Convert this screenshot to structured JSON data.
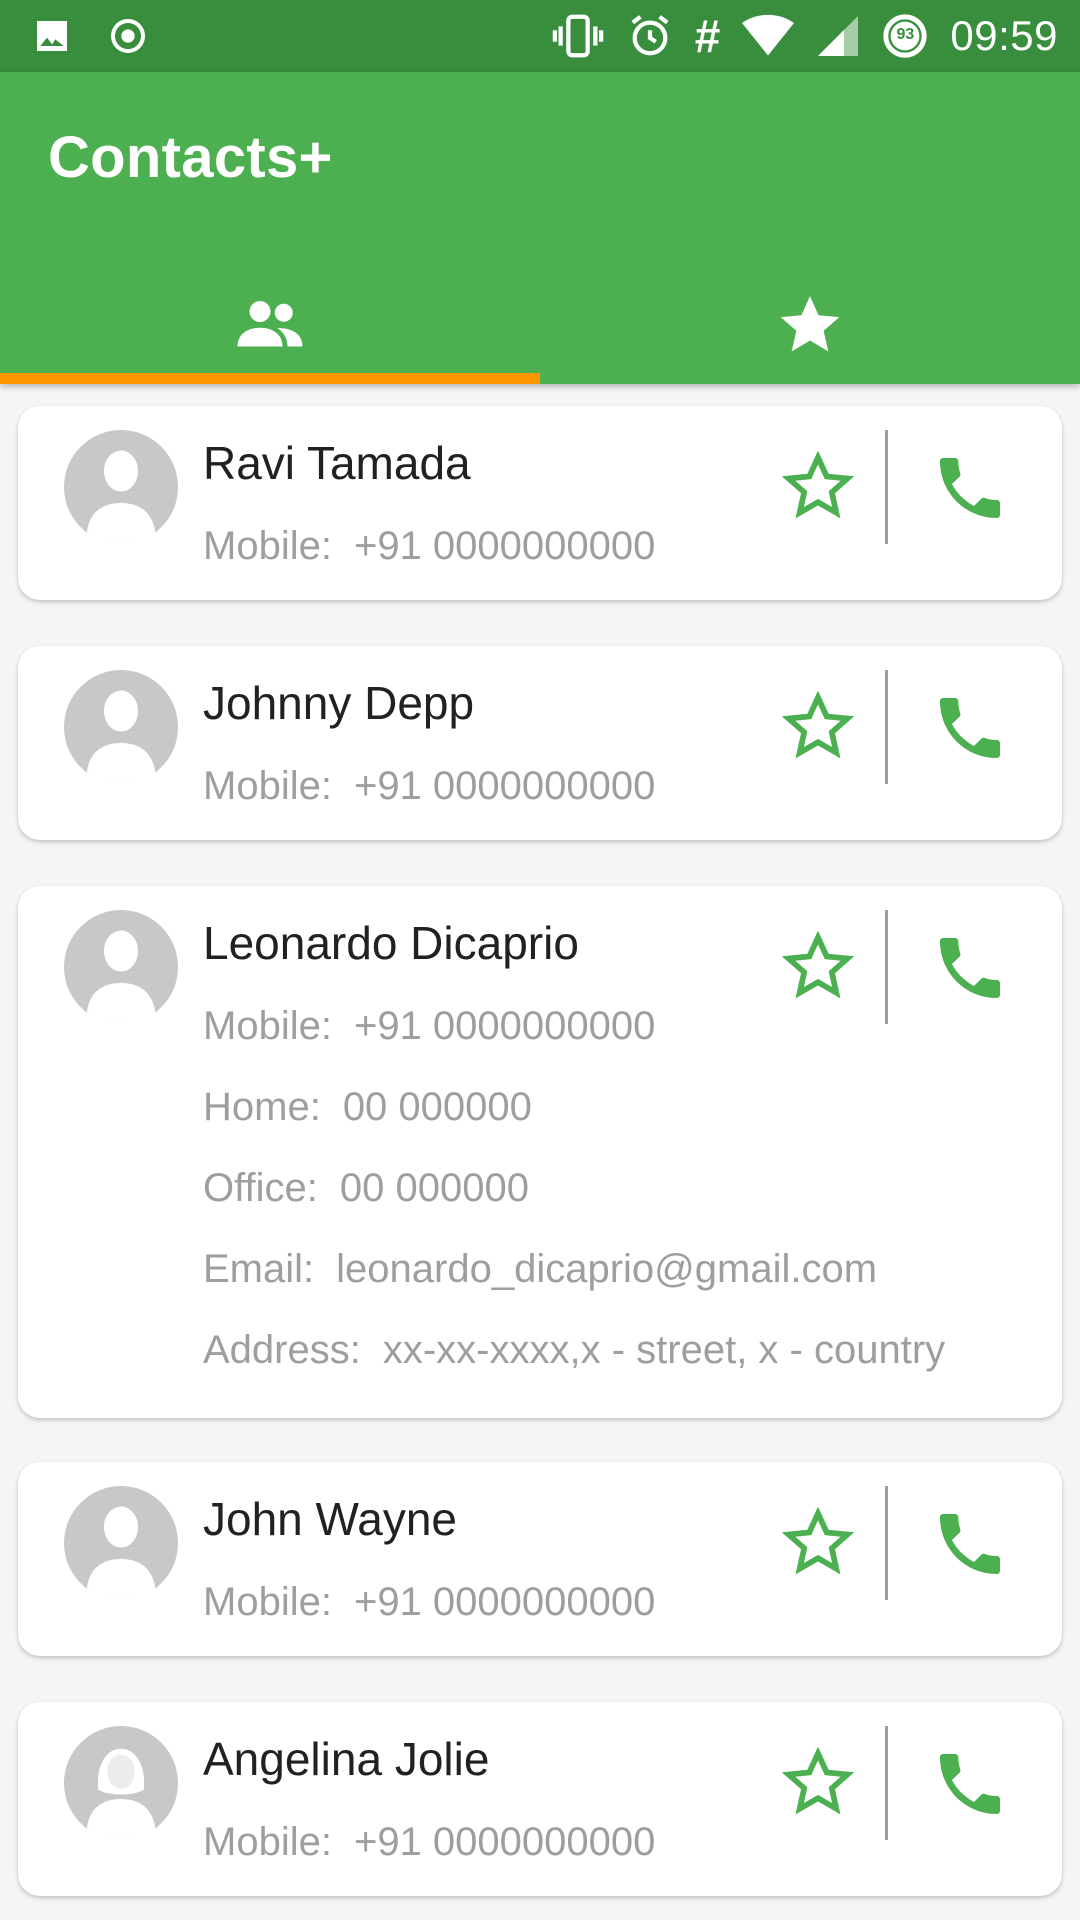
{
  "status_bar": {
    "time": "09:59",
    "battery_level": "93",
    "left_icons": [
      "image-icon",
      "record-icon"
    ],
    "right_icons": [
      "vibrate-icon",
      "alarm-icon",
      "hash-icon",
      "wifi-icon",
      "signal-icon",
      "battery-icon"
    ],
    "hash_symbol": "#"
  },
  "app_bar": {
    "title": "Contacts+",
    "color": "#4caf50",
    "status_color": "#388e3c",
    "tabs": [
      {
        "icon": "contacts-icon",
        "selected": true
      },
      {
        "icon": "star-icon",
        "selected": false
      }
    ],
    "indicator_color": "#ff9800"
  },
  "contacts": [
    {
      "name": "Ravi Tamada",
      "details": [
        {
          "label": "Mobile:",
          "value": "+91 0000000000"
        }
      ],
      "avatar": "male-avatar-icon",
      "favorite": false
    },
    {
      "name": "Johnny Depp",
      "details": [
        {
          "label": "Mobile:",
          "value": "+91 0000000000"
        }
      ],
      "avatar": "male-avatar-icon",
      "favorite": false
    },
    {
      "name": "Leonardo Dicaprio",
      "details": [
        {
          "label": "Mobile:",
          "value": "+91 0000000000"
        },
        {
          "label": "Home:",
          "value": "00 000000"
        },
        {
          "label": "Office:",
          "value": "00 000000"
        },
        {
          "label": "Email:",
          "value": "leonardo_dicaprio@gmail.com"
        },
        {
          "label": "Address:",
          "value": "xx-xx-xxxx,x - street, x - country"
        }
      ],
      "avatar": "male-avatar-icon",
      "favorite": false
    },
    {
      "name": "John Wayne",
      "details": [
        {
          "label": "Mobile:",
          "value": "+91 0000000000"
        }
      ],
      "avatar": "male-avatar-icon",
      "favorite": false
    },
    {
      "name": "Angelina Jolie",
      "details": [
        {
          "label": "Mobile:",
          "value": "+91 0000000000"
        }
      ],
      "avatar": "female-avatar-icon",
      "favorite": false
    }
  ],
  "accent_green": "#4caf50"
}
